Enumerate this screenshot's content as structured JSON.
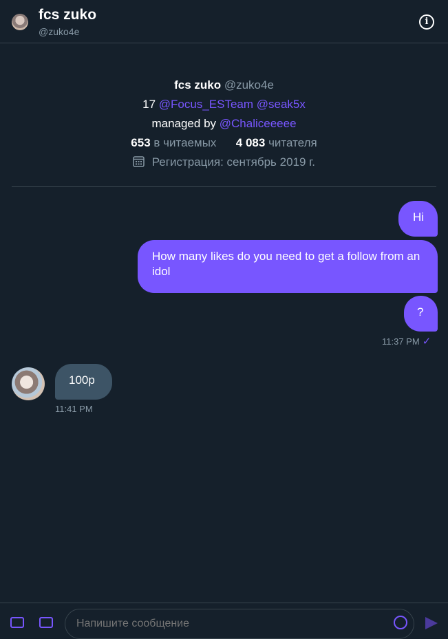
{
  "header": {
    "name": "fcs zuko",
    "handle": "@zuko4e",
    "info_glyph": "i"
  },
  "profile": {
    "name": "fcs zuko",
    "handle": "@zuko4e",
    "bio_prefix": "17",
    "bio_link1": "@Focus_ESTeam",
    "bio_link2": "@seak5x",
    "managed_prefix": "managed by",
    "managed_link": "@Chaliceeeee",
    "following_count": "653",
    "following_label": "в читаемых",
    "followers_count": "4 083",
    "followers_label": "читателя",
    "joined": "Регистрация: сентябрь 2019 г."
  },
  "messages": [
    {
      "from": "me",
      "text": "Hi"
    },
    {
      "from": "me",
      "text": "How many likes do you need to get a follow from an idol"
    },
    {
      "from": "me",
      "text": "?"
    },
    {
      "from": "them",
      "text": "100p"
    }
  ],
  "timestamps": {
    "sent": "11:37 PM",
    "received": "11:41 PM"
  },
  "composer": {
    "placeholder": "Напишите сообщение"
  },
  "colors": {
    "background": "#15202b",
    "accent": "#7856ff",
    "received_bubble": "#3d5466",
    "muted_text": "#8899a6",
    "divider": "#38444d"
  }
}
